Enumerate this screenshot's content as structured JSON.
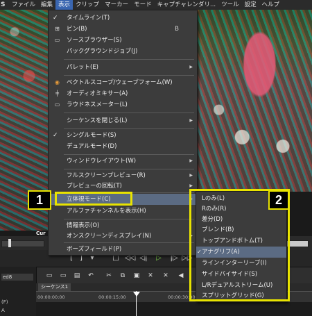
{
  "menubar": {
    "logo": "S",
    "items": [
      "ファイル",
      "編集",
      "表示",
      "クリップ",
      "マーカー",
      "モード",
      "キャプチャレンダリ...",
      "ツール",
      "設定",
      "ヘルプ"
    ],
    "active_index": 2
  },
  "video": {
    "left_caption": "Cur"
  },
  "view_menu": {
    "items": [
      {
        "label": "タイムライン(T)",
        "check": true
      },
      {
        "label": "ビン(B)",
        "icon": "bin-icon",
        "shortcut": "B"
      },
      {
        "label": "ソースブラウザー(S)",
        "icon": "source-browser-icon"
      },
      {
        "label": "バックグラウンドジョブ(J)"
      },
      {
        "label": "パレット(E)",
        "submenu": true
      },
      {
        "label": "ベクトルスコープ/ウェーブフォーム(W)",
        "icon": "vectorscope-icon"
      },
      {
        "label": "オーディオミキサー(A)",
        "icon": "audio-mixer-icon"
      },
      {
        "label": "ラウドネスメーター(L)",
        "icon": "loudness-meter-icon"
      },
      {
        "label": "シーケンスを閉じる(L)",
        "submenu": true
      },
      {
        "label": "シングルモード(S)",
        "check": true
      },
      {
        "label": "デュアルモード(D)"
      },
      {
        "label": "ウィンドウレイアウト(W)",
        "submenu": true
      },
      {
        "label": "フルスクリーンプレビュー(R)",
        "submenu": true
      },
      {
        "label": "プレビューの回転(T)",
        "submenu": true
      },
      {
        "label": "立体視モード(C)",
        "submenu": true,
        "highlighted": true
      },
      {
        "label": "アルファチャンネルを表示(H)"
      },
      {
        "label": "情報表示(O)"
      },
      {
        "label": "オンスクリーンディスプレイ(N)",
        "submenu": true
      },
      {
        "label": "ボーズフィールド(P)"
      }
    ]
  },
  "stereo_submenu": {
    "items": [
      {
        "label": "Lのみ(L)"
      },
      {
        "label": "Rのみ(R)"
      },
      {
        "label": "差分(D)"
      },
      {
        "label": "ブレンド(B)"
      },
      {
        "label": "トップアンドボトム(T)"
      },
      {
        "label": "アナグリフ(A)",
        "check": true,
        "highlighted": true
      },
      {
        "label": "ラインインターリーブ(I)"
      },
      {
        "label": "サイドバイサイド(S)"
      },
      {
        "label": "L/Rデュアルストリーム(U)"
      },
      {
        "label": "スプリットグリッド(G)"
      }
    ]
  },
  "callouts": {
    "one": "1",
    "two": "2"
  },
  "timeline": {
    "track_name": "ed8",
    "sequence_tab": "シーケンス1",
    "rows": [
      "(F)",
      "A"
    ],
    "ruler_ticks": [
      "00:00:00:00",
      "00:00:15:00",
      "00:00:30:00"
    ]
  },
  "colors": {
    "accent_yellow": "#e8e300",
    "menu_highlight": "#5b6b83",
    "menubar_active": "#3a66b0"
  }
}
